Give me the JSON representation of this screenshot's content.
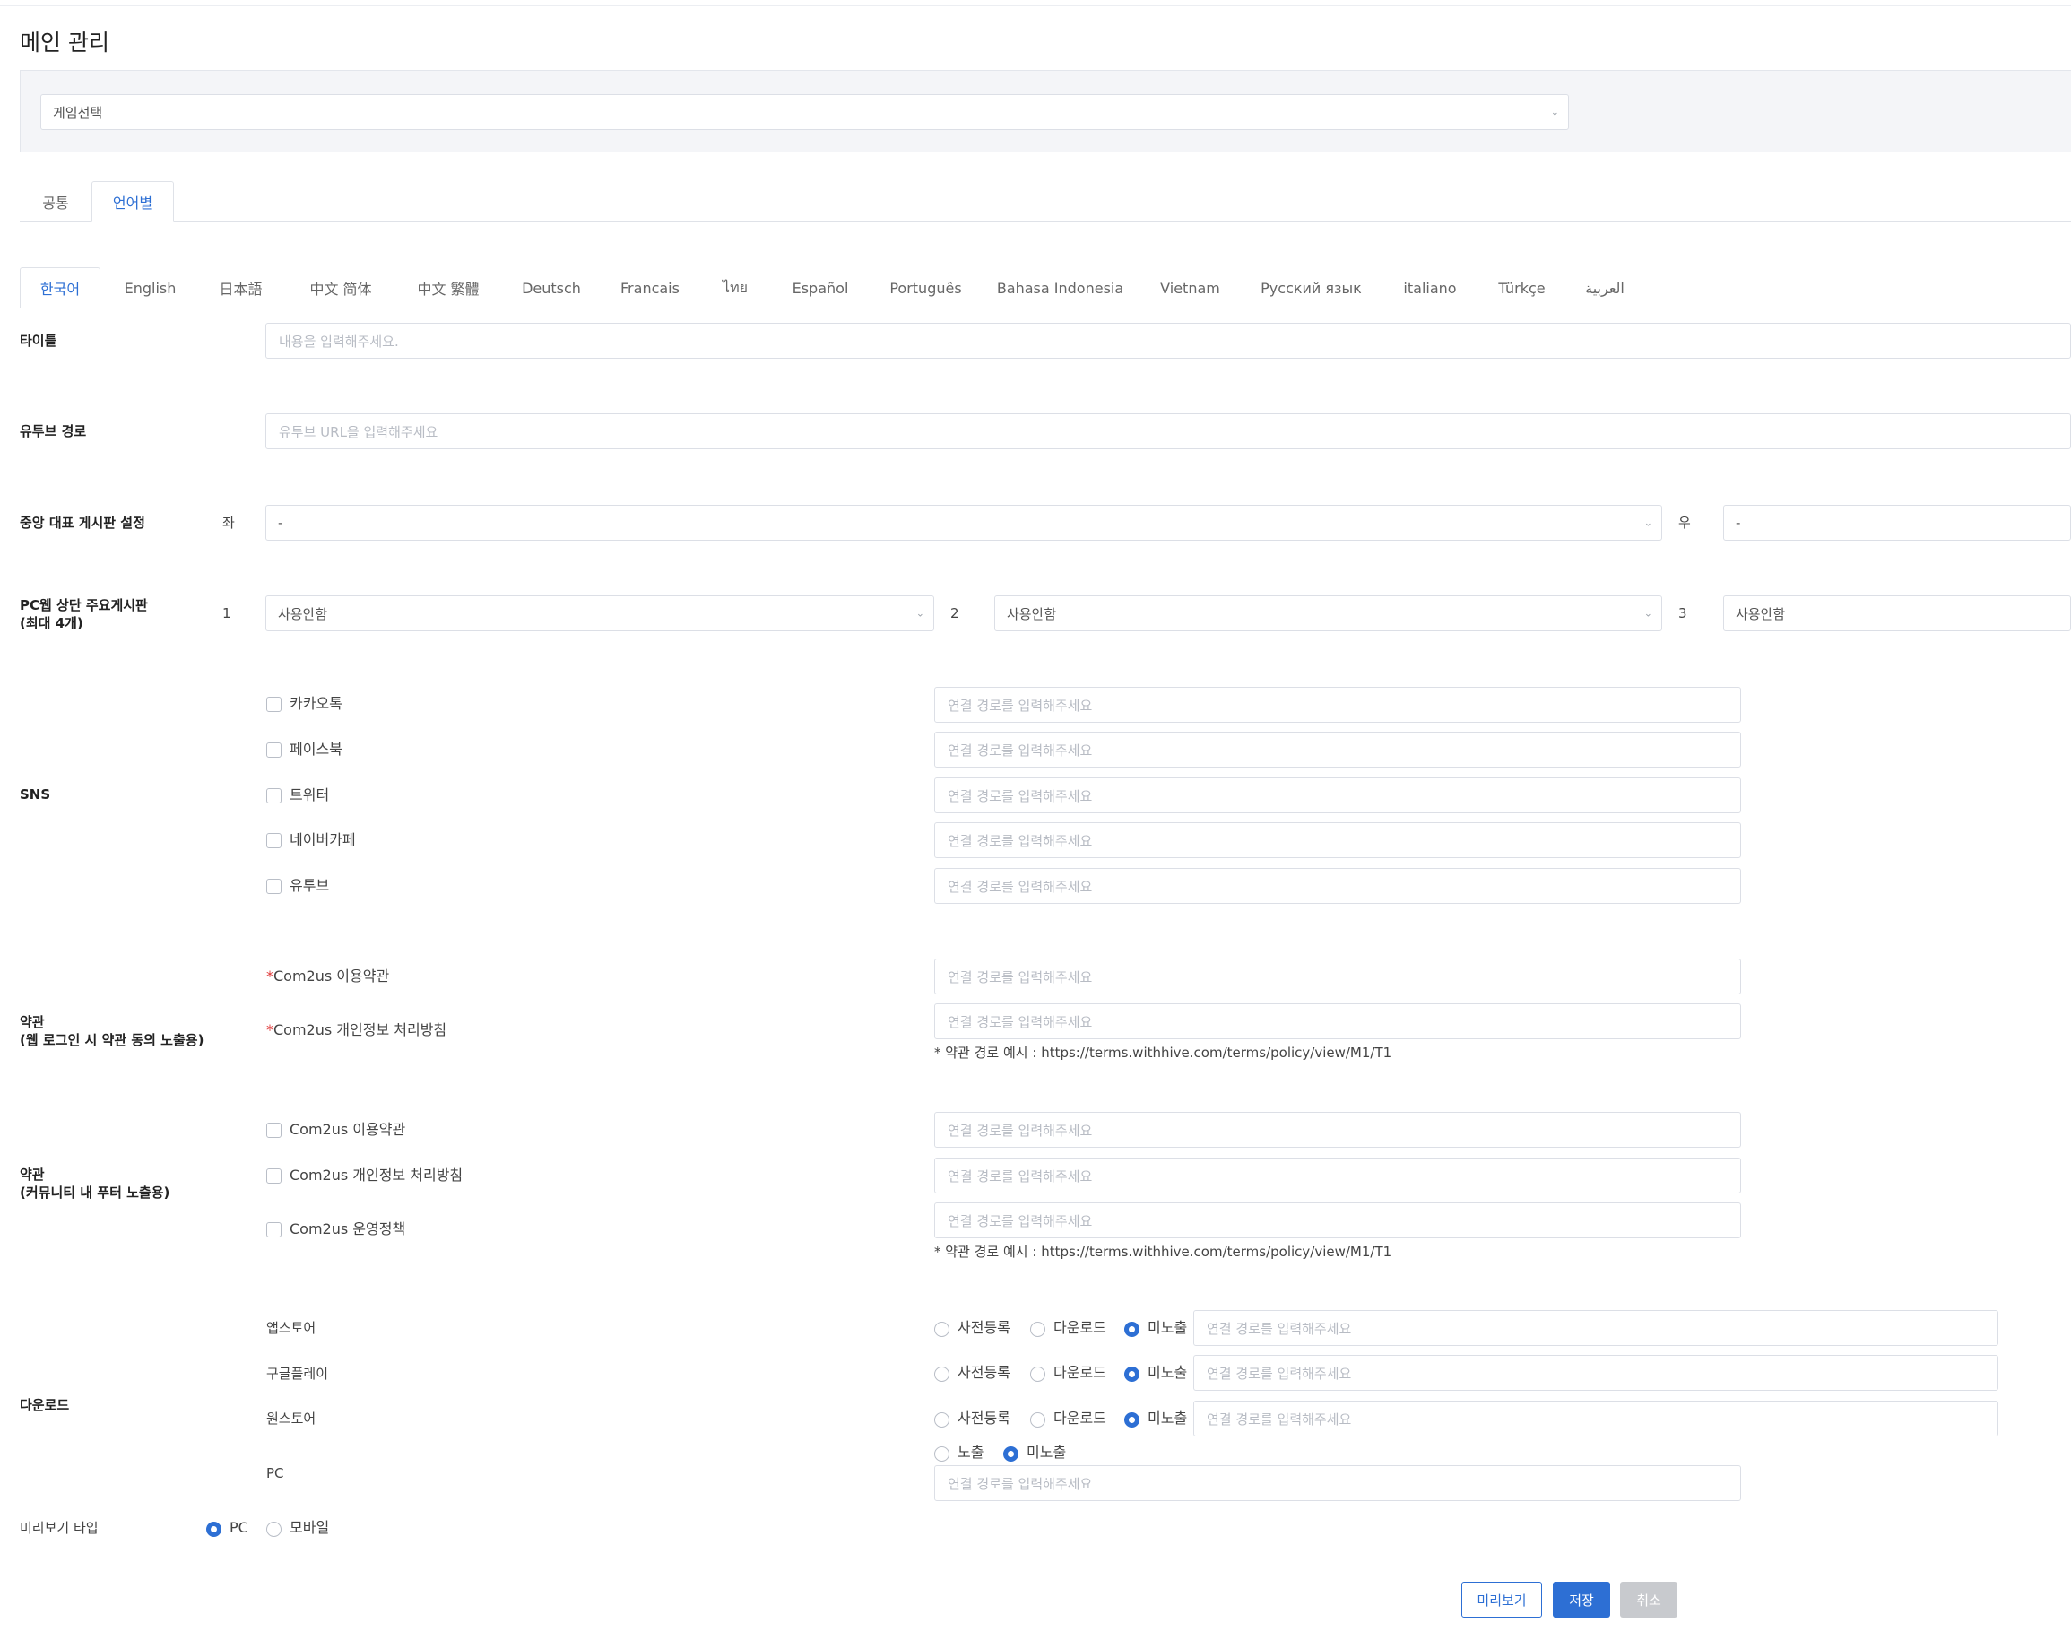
{
  "page_title": "메인 관리",
  "game_select": {
    "value": "게임선택",
    "icon": "chevron-down-icon"
  },
  "top_tabs": [
    {
      "label": "공통",
      "active": false
    },
    {
      "label": "언어별",
      "active": true
    }
  ],
  "language_tabs": [
    {
      "label": "한국어",
      "active": true
    },
    {
      "label": "English"
    },
    {
      "label": "日本語"
    },
    {
      "label": "中文 简体"
    },
    {
      "label": "中文 繁體"
    },
    {
      "label": "Deutsch"
    },
    {
      "label": "Francais"
    },
    {
      "label": "ไทย"
    },
    {
      "label": "Español"
    },
    {
      "label": "Português"
    },
    {
      "label": "Bahasa Indonesia"
    },
    {
      "label": "Vietnam"
    },
    {
      "label": "Русский язык"
    },
    {
      "label": "italiano"
    },
    {
      "label": "Türkçe"
    },
    {
      "label": "العربية"
    }
  ],
  "title_field": {
    "label": "타이틀",
    "placeholder": "내용을 입력해주세요."
  },
  "youtube_field": {
    "label": "유투브 경로",
    "placeholder": "유투브 URL을 입력해주세요"
  },
  "center_board": {
    "label": "중앙 대표 게시판 설정",
    "left_label": "좌",
    "left_value": "-",
    "right_label": "우",
    "right_value": "-"
  },
  "pc_top_board": {
    "label_line1": "PC웹 상단 주요게시판",
    "label_line2": "(최대 4개)",
    "items": [
      {
        "num": "1",
        "value": "사용안함"
      },
      {
        "num": "2",
        "value": "사용안함"
      },
      {
        "num": "3",
        "value": "사용안함"
      }
    ]
  },
  "sns": {
    "label": "SNS",
    "placeholder": "연결 경로를 입력해주세요",
    "items": [
      {
        "label": "카카오톡"
      },
      {
        "label": "페이스북"
      },
      {
        "label": "트위터"
      },
      {
        "label": "네이버카페"
      },
      {
        "label": "유투브"
      }
    ]
  },
  "terms_web": {
    "label_line1": "약관",
    "label_line2": "(웹 로그인 시 약관 동의 노출용)",
    "required_mark": "*",
    "placeholder": "연결 경로를 입력해주세요",
    "items": [
      {
        "label": "Com2us 이용약관"
      },
      {
        "label": "Com2us 개인정보 처리방침"
      }
    ],
    "note": "* 약관 경로 예시 : https://terms.withhive.com/terms/policy/view/M1/T1"
  },
  "terms_footer": {
    "label_line1": "약관",
    "label_line2": "(커뮤니티 내 푸터 노출용)",
    "placeholder": "연결 경로를 입력해주세요",
    "items": [
      {
        "label": "Com2us 이용약관"
      },
      {
        "label": "Com2us 개인정보 처리방침"
      },
      {
        "label": "Com2us 운영정책"
      }
    ],
    "note": "* 약관 경로 예시 : https://terms.withhive.com/terms/policy/view/M1/T1"
  },
  "download": {
    "label": "다운로드",
    "placeholder": "연결 경로를 입력해주세요",
    "stores": [
      {
        "label": "앱스토어",
        "options": [
          "사전등록",
          "다운로드",
          "미노출"
        ],
        "selected": "미노출"
      },
      {
        "label": "구글플레이",
        "options": [
          "사전등록",
          "다운로드",
          "미노출"
        ],
        "selected": "미노출"
      },
      {
        "label": "원스토어",
        "options": [
          "사전등록",
          "다운로드",
          "미노출"
        ],
        "selected": "미노출"
      }
    ],
    "pc": {
      "label": "PC",
      "options": [
        "노출",
        "미노출"
      ],
      "selected": "미노출"
    }
  },
  "preview_type": {
    "label": "미리보기 타입",
    "options": [
      "PC",
      "모바일"
    ],
    "selected": "PC"
  },
  "buttons": {
    "preview": "미리보기",
    "save": "저장",
    "cancel": "취소"
  },
  "colors": {
    "accent": "#2d6fd4",
    "required": "#e03a3a",
    "disabled": "#c8cace"
  }
}
